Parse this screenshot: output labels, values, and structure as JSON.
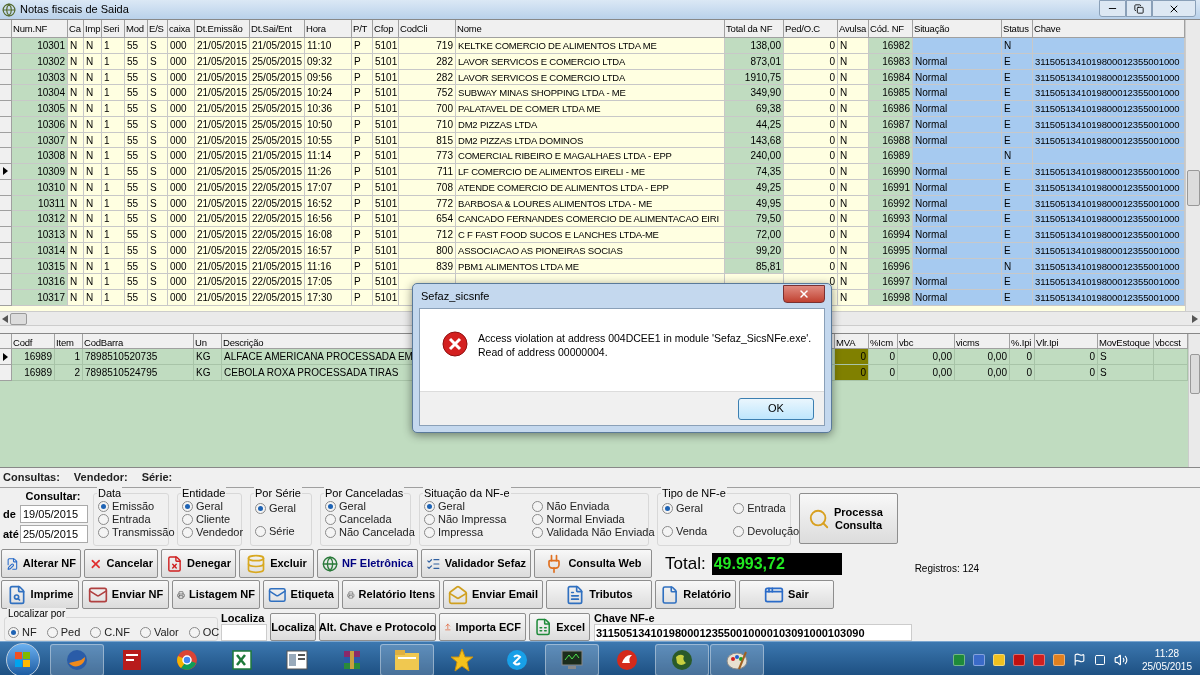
{
  "window": {
    "title": "Notas fiscais de Saida"
  },
  "invoices": {
    "columns": [
      "Num.NF",
      "Ca",
      "Imp",
      "Seri",
      "Mod",
      "E/S",
      "caixa",
      "Dt.Emissão",
      "Dt.Sai/Ent",
      "Hora",
      "P/T",
      "Cfop",
      "CodCli",
      "Nome",
      "Total da NF",
      "Ped/O.C",
      "Avulsa",
      "Cód. NF",
      "Situação",
      "Status",
      "Chave"
    ],
    "rows": [
      {
        "selected": false,
        "cells": [
          "10301",
          "N",
          "N",
          "1",
          "55",
          "S",
          "000",
          "21/05/2015",
          "21/05/2015",
          "11:10",
          "P",
          "5101",
          "719",
          "KELTKE COMERCIO DE ALIMENTOS LTDA ME",
          "138,00",
          "0",
          "N",
          "16982",
          null,
          "N",
          null
        ]
      },
      {
        "selected": false,
        "cells": [
          "10302",
          "N",
          "N",
          "1",
          "55",
          "S",
          "000",
          "21/05/2015",
          "25/05/2015",
          "09:32",
          "P",
          "5101",
          "282",
          "LAVOR SERVICOS E COMERCIO LTDA",
          "873,01",
          "0",
          "N",
          "16983",
          "Normal",
          "E",
          "3115051341019800012355001000"
        ]
      },
      {
        "selected": false,
        "cells": [
          "10303",
          "N",
          "N",
          "1",
          "55",
          "S",
          "000",
          "21/05/2015",
          "25/05/2015",
          "09:56",
          "P",
          "5101",
          "282",
          "LAVOR SERVICOS E COMERCIO LTDA",
          "1910,75",
          "0",
          "N",
          "16984",
          "Normal",
          "E",
          "3115051341019800012355001000"
        ]
      },
      {
        "selected": false,
        "cells": [
          "10304",
          "N",
          "N",
          "1",
          "55",
          "S",
          "000",
          "21/05/2015",
          "25/05/2015",
          "10:24",
          "P",
          "5101",
          "752",
          "SUBWAY MINAS SHOPPING LTDA - ME",
          "349,90",
          "0",
          "N",
          "16985",
          "Normal",
          "E",
          "3115051341019800012355001000"
        ]
      },
      {
        "selected": false,
        "cells": [
          "10305",
          "N",
          "N",
          "1",
          "55",
          "S",
          "000",
          "21/05/2015",
          "25/05/2015",
          "10:36",
          "P",
          "5101",
          "700",
          "PALATAVEL DE COMER LTDA ME",
          "69,38",
          "0",
          "N",
          "16986",
          "Normal",
          "E",
          "3115051341019800012355001000"
        ]
      },
      {
        "selected": false,
        "cells": [
          "10306",
          "N",
          "N",
          "1",
          "55",
          "S",
          "000",
          "21/05/2015",
          "25/05/2015",
          "10:50",
          "P",
          "5101",
          "710",
          "DM2 PIZZAS LTDA",
          "44,25",
          "0",
          "N",
          "16987",
          "Normal",
          "E",
          "3115051341019800012355001000"
        ]
      },
      {
        "selected": false,
        "cells": [
          "10307",
          "N",
          "N",
          "1",
          "55",
          "S",
          "000",
          "21/05/2015",
          "25/05/2015",
          "10:55",
          "P",
          "5101",
          "815",
          "DM2 PIZZAS LTDA DOMINOS",
          "143,68",
          "0",
          "N",
          "16988",
          "Normal",
          "E",
          "3115051341019800012355001000"
        ]
      },
      {
        "selected": false,
        "cells": [
          "10308",
          "N",
          "N",
          "1",
          "55",
          "S",
          "000",
          "21/05/2015",
          "21/05/2015",
          "11:14",
          "P",
          "5101",
          "773",
          "COMERCIAL RIBEIRO E MAGALHAES LTDA - EPP",
          "240,00",
          "0",
          "N",
          "16989",
          null,
          "N",
          null
        ]
      },
      {
        "selected": true,
        "cells": [
          "10309",
          "N",
          "N",
          "1",
          "55",
          "S",
          "000",
          "21/05/2015",
          "25/05/2015",
          "11:26",
          "P",
          "5101",
          "711",
          "LF COMERCIO DE ALIMENTOS EIRELI - ME",
          "74,35",
          "0",
          "N",
          "16990",
          "Normal",
          "E",
          "3115051341019800012355001000"
        ]
      },
      {
        "selected": false,
        "cells": [
          "10310",
          "N",
          "N",
          "1",
          "55",
          "S",
          "000",
          "21/05/2015",
          "22/05/2015",
          "17:07",
          "P",
          "5101",
          "708",
          "ATENDE COMERCIO DE ALIMENTOS LTDA - EPP",
          "49,25",
          "0",
          "N",
          "16991",
          "Normal",
          "E",
          "3115051341019800012355001000"
        ]
      },
      {
        "selected": false,
        "cells": [
          "10311",
          "N",
          "N",
          "1",
          "55",
          "S",
          "000",
          "21/05/2015",
          "22/05/2015",
          "16:52",
          "P",
          "5101",
          "772",
          "BARBOSA & LOURES ALIMENTOS LTDA - ME",
          "49,95",
          "0",
          "N",
          "16992",
          "Normal",
          "E",
          "3115051341019800012355001000"
        ]
      },
      {
        "selected": false,
        "cells": [
          "10312",
          "N",
          "N",
          "1",
          "55",
          "S",
          "000",
          "21/05/2015",
          "22/05/2015",
          "16:56",
          "P",
          "5101",
          "654",
          "CANCADO FERNANDES COMERCIO DE ALIMENTACAO EIRI",
          "79,50",
          "0",
          "N",
          "16993",
          "Normal",
          "E",
          "3115051341019800012355001000"
        ]
      },
      {
        "selected": false,
        "cells": [
          "10313",
          "N",
          "N",
          "1",
          "55",
          "S",
          "000",
          "21/05/2015",
          "22/05/2015",
          "16:08",
          "P",
          "5101",
          "712",
          "C F FAST FOOD SUCOS E LANCHES LTDA-ME",
          "72,00",
          "0",
          "N",
          "16994",
          "Normal",
          "E",
          "3115051341019800012355001000"
        ]
      },
      {
        "selected": false,
        "cells": [
          "10314",
          "N",
          "N",
          "1",
          "55",
          "S",
          "000",
          "21/05/2015",
          "22/05/2015",
          "16:57",
          "P",
          "5101",
          "800",
          "ASSOCIACAO AS PIONEIRAS SOCIAS",
          "99,20",
          "0",
          "N",
          "16995",
          "Normal",
          "E",
          "3115051341019800012355001000"
        ]
      },
      {
        "selected": false,
        "cells": [
          "10315",
          "N",
          "N",
          "1",
          "55",
          "S",
          "000",
          "21/05/2015",
          "21/05/2015",
          "11:16",
          "P",
          "5101",
          "839",
          "PBM1 ALIMENTOS LTDA ME",
          "85,81",
          "0",
          "N",
          "16996",
          null,
          "N",
          "3115051341019800012355001000"
        ]
      },
      {
        "selected": false,
        "cells": [
          "10316",
          "N",
          "N",
          "1",
          "55",
          "S",
          "000",
          "21/05/2015",
          "22/05/2015",
          "17:05",
          "P",
          "5101",
          null,
          null,
          null,
          "0",
          "N",
          "16997",
          "Normal",
          "E",
          "3115051341019800012355001000"
        ]
      },
      {
        "selected": false,
        "cells": [
          "10317",
          "N",
          "N",
          "1",
          "55",
          "S",
          "000",
          "21/05/2015",
          "22/05/2015",
          "17:30",
          "P",
          "5101",
          null,
          null,
          null,
          null,
          "N",
          "16998",
          "Normal",
          "E",
          "3115051341019800012355001000"
        ]
      }
    ]
  },
  "items": {
    "columns": [
      "Codf",
      "Item",
      "CodBarra",
      "Un",
      "Descrição",
      "MVA",
      "%Icm",
      "vbc",
      "vicms",
      "%.Ipi",
      "Vlr.Ipi",
      "MovEstoque",
      "vbccst"
    ],
    "rows": [
      {
        "selected": true,
        "cells": [
          "16989",
          "1",
          "7898510520735",
          "KG",
          "ALFACE AMERICANA PROCESSADA EM",
          "0",
          "0",
          "0,00",
          "0,00",
          "0",
          "0",
          "S",
          null
        ]
      },
      {
        "selected": false,
        "cells": [
          "16989",
          "2",
          "7898510524795",
          "KG",
          "CEBOLA ROXA PROCESSADA TIRAS",
          "0",
          "0",
          "0,00",
          "0,00",
          "0",
          "0",
          "S",
          null
        ]
      }
    ]
  },
  "dialog": {
    "title": "Sefaz_sicsnfe",
    "message": [
      "Access violation at address 004DCEE1 in module 'Sefaz_SicsNFe.exe'.",
      "Read of address 00000004."
    ],
    "button": "OK"
  },
  "summary": [
    "Consultas:",
    "Vendedor:",
    "Série:"
  ],
  "query": {
    "label": "Consultar:",
    "from_label": "de",
    "from": "19/05/2015",
    "to_label": "até",
    "to": "25/05/2015"
  },
  "filter_groups": [
    {
      "label": "Data",
      "columns": [
        [
          {
            "label": "Emissão",
            "selected": true
          },
          {
            "label": "Entrada",
            "selected": false
          },
          {
            "label": "Transmissão",
            "selected": false
          }
        ]
      ]
    },
    {
      "label": "Entidade",
      "columns": [
        [
          {
            "label": "Geral",
            "selected": true
          },
          {
            "label": "Cliente",
            "selected": false
          },
          {
            "label": "Vendedor",
            "selected": false
          }
        ]
      ]
    },
    {
      "label": "Por Série",
      "columns": [
        [
          {
            "label": "Geral",
            "selected": true
          },
          {
            "label": "Série",
            "selected": false
          }
        ]
      ]
    },
    {
      "label": "Por Canceladas",
      "columns": [
        [
          {
            "label": "Geral",
            "selected": true
          },
          {
            "label": "Cancelada",
            "selected": false
          },
          {
            "label": "Não Cancelada",
            "selected": false
          }
        ]
      ]
    },
    {
      "label": "Situação da NF-e",
      "columns": [
        [
          {
            "label": "Geral",
            "selected": true
          },
          {
            "label": "Não Impressa",
            "selected": false
          },
          {
            "label": "Impressa",
            "selected": false
          }
        ],
        [
          {
            "label": "Não Enviada",
            "selected": false
          },
          {
            "label": "Normal Enviada",
            "selected": false
          },
          {
            "label": "Validada Não Enviada",
            "selected": false
          }
        ]
      ]
    },
    {
      "label": "Tipo de NF-e",
      "columns": [
        [
          {
            "label": "Geral",
            "selected": true
          },
          {
            "label": "Venda",
            "selected": false
          }
        ],
        [
          {
            "label": "Entrada",
            "selected": false
          },
          {
            "label": "Devolução",
            "selected": false
          }
        ]
      ]
    }
  ],
  "process_button": [
    "Processa",
    "Consulta"
  ],
  "button_rows": [
    [
      {
        "label": "Alterar NF"
      },
      {
        "label": "Cancelar"
      },
      {
        "label": "Denegar"
      },
      {
        "label": "Excluir"
      },
      {
        "label": "NF Eletrônica",
        "color": "#000080"
      },
      {
        "label": "Validador Sefaz"
      },
      {
        "label": "Consulta Web"
      }
    ],
    [
      {
        "label": "Imprime"
      },
      {
        "label": "Enviar NF"
      },
      {
        "label": "Listagem NF"
      },
      {
        "label": "Etiqueta"
      },
      {
        "label": "Relatório Itens"
      },
      {
        "label": "Enviar Email"
      },
      {
        "label": "Tributos"
      },
      {
        "label": "Relatório"
      },
      {
        "label": "Sair"
      }
    ]
  ],
  "total": {
    "label": "Total:",
    "value": "49.993,72"
  },
  "records": "Registros: 124",
  "locate": {
    "group_label": "Localizar por",
    "options": [
      {
        "label": "NF",
        "selected": true
      },
      {
        "label": "Ped",
        "selected": false
      },
      {
        "label": "C.NF",
        "selected": false
      },
      {
        "label": "Valor",
        "selected": false
      },
      {
        "label": "OC",
        "selected": false
      }
    ],
    "field_label": "Localiza",
    "buttons": [
      "Localiza",
      "Alt. Chave e Protocolo",
      "Importa ECF",
      "Excel"
    ],
    "key_label": "Chave NF-e",
    "key_value": "31150513410198000123550010000103091000103090"
  },
  "taskbar": {
    "time": "11:28",
    "date": "25/05/2015"
  }
}
